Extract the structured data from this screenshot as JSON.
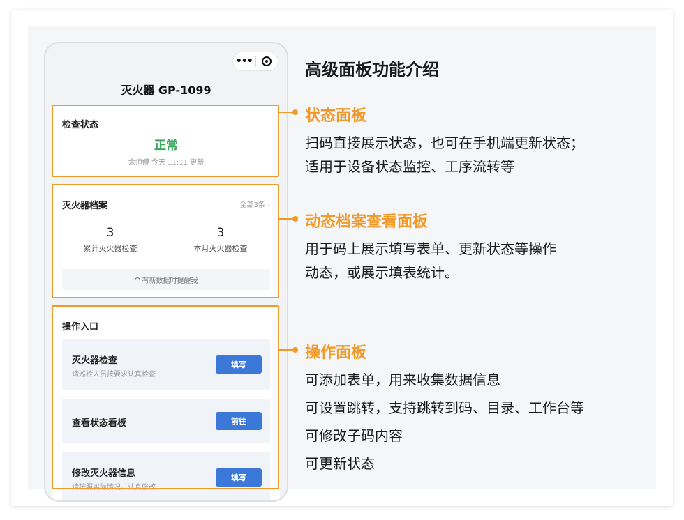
{
  "phone": {
    "capsule_more": "•••",
    "title": "灭火器 GP-1099",
    "status_panel": {
      "heading": "检查状态",
      "value": "正常",
      "meta": "余师傅 今天 11:11 更新"
    },
    "archive_panel": {
      "heading": "灭火器档案",
      "all_link": "全部3条 ›",
      "stats": [
        {
          "value": "3",
          "label": "累计灭火器检查"
        },
        {
          "value": "3",
          "label": "本月灭火器检查"
        }
      ],
      "remind": "有新数据时提醒我"
    },
    "ops_panel": {
      "heading": "操作入口",
      "items": [
        {
          "title": "灭火器检查",
          "subtitle": "请巡检人员按要求认真检查",
          "button": "填写"
        },
        {
          "title": "查看状态看板",
          "subtitle": "",
          "button": "前往"
        },
        {
          "title": "修改灭火器信息",
          "subtitle": "请按照实际情况，认真修改",
          "button": "填写"
        }
      ]
    }
  },
  "intro": {
    "title": "高级面板功能介绍",
    "sections": [
      {
        "title": "状态面板",
        "lines": [
          "扫码直接展示状态，也可在手机端更新状态；",
          "适用于设备状态监控、工序流转等"
        ]
      },
      {
        "title": "动态档案查看面板",
        "lines": [
          "用于码上展示填写表单、更新状态等操作",
          "动态，或展示填表统计。"
        ]
      },
      {
        "title": "操作面板",
        "lines": [
          "可添加表单，用来收集数据信息",
          "可设置跳转，支持跳转到码、目录、工作台等",
          "可修改子码内容",
          "可更新状态"
        ]
      }
    ]
  },
  "colors": {
    "accent": "#f19a2c",
    "status_ok": "#3aa95d",
    "button": "#3c78d8"
  }
}
